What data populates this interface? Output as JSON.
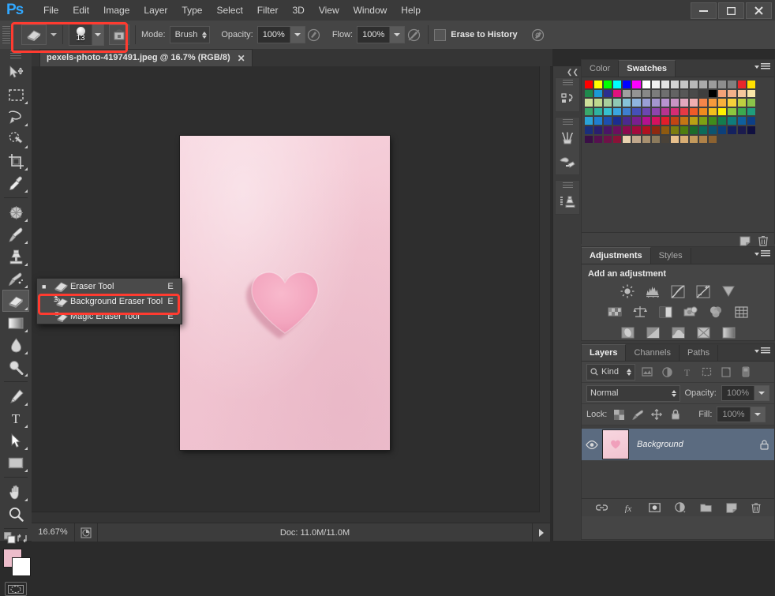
{
  "app": {
    "logo": "Ps",
    "menus": [
      "File",
      "Edit",
      "Image",
      "Layer",
      "Type",
      "Select",
      "Filter",
      "3D",
      "View",
      "Window",
      "Help"
    ],
    "window_controls": [
      {
        "name": "minimize",
        "glyph": "—"
      },
      {
        "name": "maximize",
        "glyph": "❐"
      },
      {
        "name": "close",
        "glyph": "✕"
      }
    ]
  },
  "options_bar": {
    "tool_preset_name": "eraser-tool-preset",
    "brush_size": "13",
    "mode_label": "Mode:",
    "mode_value": "Brush",
    "opacity_label": "Opacity:",
    "opacity_value": "100%",
    "flow_label": "Flow:",
    "flow_value": "100%",
    "erase_to_history_label": "Erase to History",
    "erase_to_history_checked": false,
    "airbrush_title": "airbrush",
    "tablet_opacity_title": "tablet-pressure-opacity",
    "tablet_size_title": "tablet-pressure-size"
  },
  "toolbar": {
    "tools": [
      {
        "name": "move-tool",
        "has_submenu": false
      },
      {
        "name": "rectangular-marquee-tool",
        "has_submenu": true
      },
      {
        "name": "lasso-tool",
        "has_submenu": true
      },
      {
        "name": "quick-selection-tool",
        "has_submenu": true
      },
      {
        "name": "crop-tool",
        "has_submenu": true
      },
      {
        "name": "eyedropper-tool",
        "has_submenu": true
      },
      {
        "name": "spot-healing-brush-tool",
        "has_submenu": true
      },
      {
        "name": "brush-tool",
        "has_submenu": true
      },
      {
        "name": "clone-stamp-tool",
        "has_submenu": true
      },
      {
        "name": "history-brush-tool",
        "has_submenu": true
      },
      {
        "name": "eraser-tool",
        "has_submenu": true,
        "active": true
      },
      {
        "name": "gradient-tool",
        "has_submenu": true
      },
      {
        "name": "blur-tool",
        "has_submenu": true
      },
      {
        "name": "dodge-tool",
        "has_submenu": true
      },
      {
        "name": "pen-tool",
        "has_submenu": true
      },
      {
        "name": "horizontal-type-tool",
        "has_submenu": true
      },
      {
        "name": "path-selection-tool",
        "has_submenu": true
      },
      {
        "name": "rectangle-tool",
        "has_submenu": true
      },
      {
        "name": "hand-tool",
        "has_submenu": true
      },
      {
        "name": "zoom-tool",
        "has_submenu": false
      }
    ],
    "foreground_color": "#edbdcb",
    "background_color": "#ffffff"
  },
  "document": {
    "tab_title": "pexels-photo-4197491.jpeg @ 16.7% (RGB/8)",
    "close_glyph": "✕",
    "canvas_bg": "#f2c6d2",
    "heart_color": "#f4a9c0"
  },
  "status_bar": {
    "zoom": "16.67%",
    "doc_info": "Doc: 11.0M/11.0M",
    "arrow_glyph": "▶"
  },
  "tool_flyout": {
    "items": [
      {
        "label": "Eraser Tool",
        "shortcut": "E",
        "icon": "eraser-icon",
        "selected_marker": "■",
        "highlighted": false
      },
      {
        "label": "Background Eraser Tool",
        "shortcut": "E",
        "icon": "background-eraser-icon",
        "selected_marker": "",
        "highlighted": true
      },
      {
        "label": "Magic Eraser Tool",
        "shortcut": "E",
        "icon": "magic-eraser-icon",
        "selected_marker": "",
        "highlighted": false
      }
    ]
  },
  "icon_dock": {
    "groups": [
      [
        "history-panel-icon"
      ],
      [
        "brush-panel-icon",
        "brush-presets-icon"
      ],
      [
        "clone-source-icon"
      ]
    ]
  },
  "color_panel": {
    "tabs": [
      {
        "label": "Color",
        "active": false
      },
      {
        "label": "Swatches",
        "active": true
      }
    ],
    "swatches": [
      "#ff0000",
      "#ffff00",
      "#00ff00",
      "#00ffff",
      "#0000ff",
      "#ff00ff",
      "#ffffff",
      "#f0f0f0",
      "#e2e2e2",
      "#d4d4d4",
      "#c6c6c6",
      "#b8b8b8",
      "#aaaaaa",
      "#9c9c9c",
      "#8e8e8e",
      "#808080",
      "#e8272b",
      "#ffe000",
      "#1f8a4c",
      "#1b9ad6",
      "#2b2f8f",
      "#e0107f",
      "#a0a0a0",
      "#949494",
      "#888888",
      "#7c7c7c",
      "#6f6f6f",
      "#636363",
      "#575757",
      "#4a4a4a",
      "#3e3e3e",
      "#000000",
      "#f4a278",
      "#f3b08a",
      "#f6c79c",
      "#f9e6a8",
      "#cfe09a",
      "#bfd88e",
      "#a8cf9c",
      "#8fc9b4",
      "#86c3d8",
      "#8fb4de",
      "#9a9fd6",
      "#a596cf",
      "#b894cf",
      "#c995c4",
      "#e3a8bf",
      "#f0aeb2",
      "#f4854a",
      "#f69a3c",
      "#f7b03c",
      "#f7d13a",
      "#bfd040",
      "#8bc34a",
      "#3aa86b",
      "#2fb3a0",
      "#36c0cf",
      "#3aa6e0",
      "#3e7fd0",
      "#4550b8",
      "#6b47b0",
      "#8e44ad",
      "#b8338f",
      "#d62c74",
      "#e53945",
      "#ef5b28",
      "#f08b1e",
      "#f2c01c",
      "#fff200",
      "#8cc63f",
      "#3ba94f",
      "#1f9c7c",
      "#2aa3d8",
      "#1f7fd0",
      "#1d4fae",
      "#1b2d8f",
      "#4b2a8f",
      "#7a1f8f",
      "#b4118f",
      "#d6115f",
      "#e21d2b",
      "#c44414",
      "#c47614",
      "#b9a114",
      "#7da113",
      "#3f8c1c",
      "#147c4e",
      "#0f7c7c",
      "#0f5f9e",
      "#0d3f86",
      "#1a2f7a",
      "#2a1f6e",
      "#4a1566",
      "#6b0f5e",
      "#8c0a4f",
      "#a30a3c",
      "#b01020",
      "#8f2810",
      "#8f5a10",
      "#7d7d10",
      "#4e7d10",
      "#1c6b2a",
      "#0c6b5a",
      "#0c5470",
      "#0c3f7a",
      "#14215f",
      "#1b1b4e",
      "#101040",
      "#3a0f46",
      "#55114f",
      "#6e1248",
      "#8a1238",
      "#e8d2b0",
      "#c0a78c",
      "#a89070",
      "#8c7a5c",
      "#4a4238",
      "#e8c08c",
      "#d9ae74",
      "#c49a5c",
      "#b08248",
      "#8c6230",
      "#3f3f3f",
      "#3f3f3f",
      "#3f3f3f",
      "#3f3f3f"
    ],
    "footer_icons": [
      "new-swatch-icon",
      "delete-swatch-icon"
    ]
  },
  "adjustments_panel": {
    "tabs": [
      {
        "label": "Adjustments",
        "active": true
      },
      {
        "label": "Styles",
        "active": false
      }
    ],
    "title": "Add an adjustment",
    "rows": [
      [
        "brightness-contrast-icon",
        "levels-icon",
        "curves-icon",
        "exposure-icon",
        "vibrance-icon"
      ],
      [
        "hue-saturation-icon",
        "color-balance-icon",
        "black-white-icon",
        "photo-filter-icon",
        "channel-mixer-icon",
        "color-lookup-icon"
      ],
      [
        "invert-icon",
        "posterize-icon",
        "threshold-icon",
        "selective-color-icon",
        "gradient-map-icon"
      ]
    ]
  },
  "layers_panel": {
    "tabs": [
      {
        "label": "Layers",
        "active": true
      },
      {
        "label": "Channels",
        "active": false
      },
      {
        "label": "Paths",
        "active": false
      }
    ],
    "filter_label": "Kind",
    "filter_icons": [
      "pixel-filter-icon",
      "adjustment-filter-icon",
      "type-filter-icon",
      "shape-filter-icon",
      "smartobject-filter-icon"
    ],
    "blend_mode": "Normal",
    "opacity_label": "Opacity:",
    "opacity_value": "100%",
    "lock_label": "Lock:",
    "lock_icons": [
      "lock-transparency-icon",
      "lock-image-icon",
      "lock-position-icon",
      "lock-all-icon"
    ],
    "fill_label": "Fill:",
    "fill_value": "100%",
    "layers": [
      {
        "name": "Background",
        "visible": true,
        "locked": true,
        "selected": true
      }
    ],
    "footer_icons": [
      "link-layers-icon",
      "layer-style-fx-icon",
      "add-mask-icon",
      "new-adjustment-icon",
      "new-group-icon",
      "new-layer-icon",
      "delete-layer-icon"
    ]
  },
  "highlights": {
    "accent_color": "#ff3b30"
  }
}
